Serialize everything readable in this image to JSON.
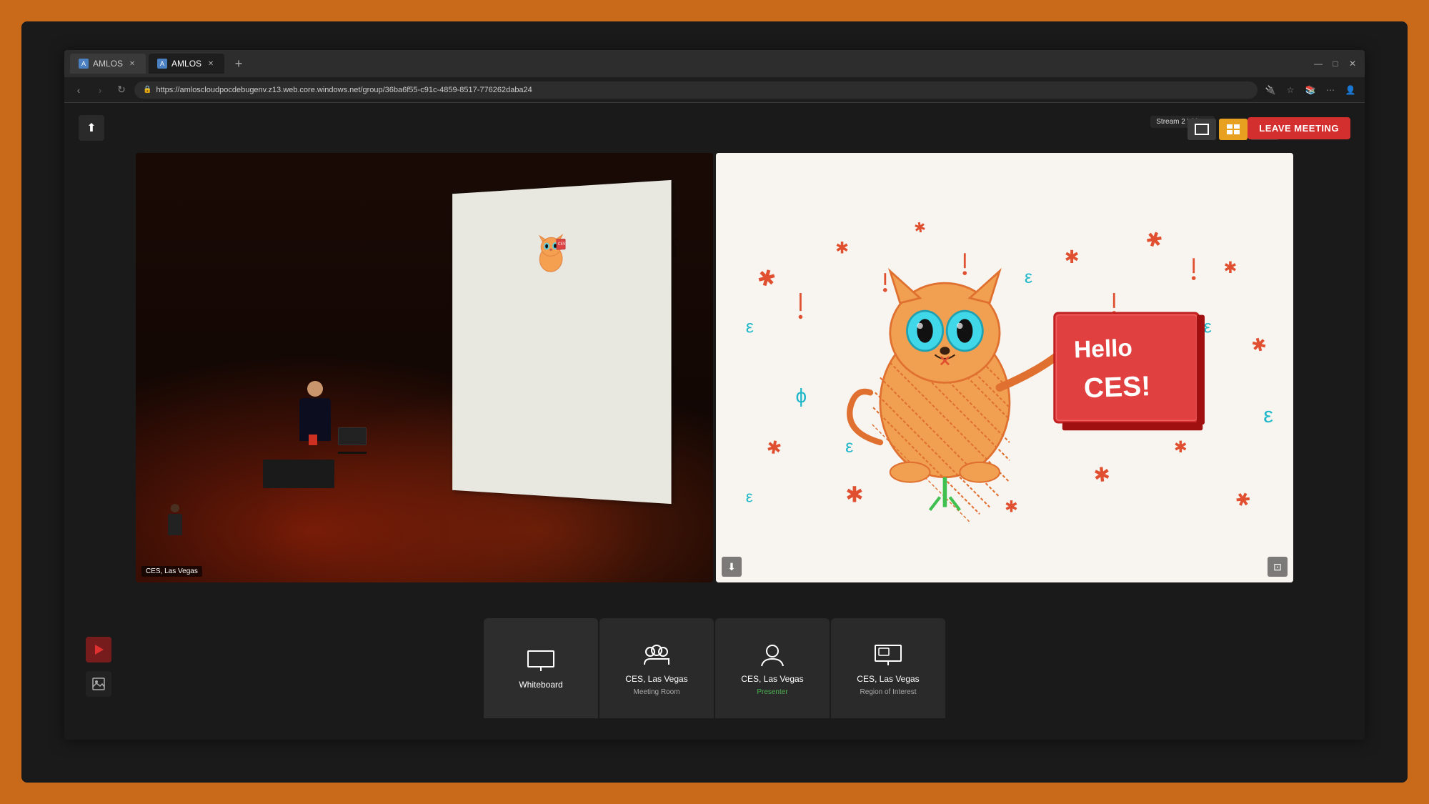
{
  "browser": {
    "tabs": [
      {
        "label": "AMLOS",
        "active": false,
        "id": "tab1"
      },
      {
        "label": "AMLOS",
        "active": true,
        "id": "tab2"
      }
    ],
    "url": "https://amloscloudpocdebugenv.z13.web.core.windows.net/group/36ba6f55-c91c-4859-8517-776262daba24",
    "new_tab_label": "+",
    "window_controls": {
      "minimize": "—",
      "maximize": "□",
      "close": "✕"
    }
  },
  "meeting": {
    "stream_label": "Stream 2 Videos",
    "leave_button_label": "LEAVE MEETING",
    "upload_icon": "⬆",
    "view_modes": [
      "single",
      "gallery",
      "list"
    ]
  },
  "videos": {
    "left": {
      "location": "CES, Las Vegas"
    },
    "right": {
      "hello_text": "Hello CES!"
    }
  },
  "bottom_bar": {
    "side_icons": [
      {
        "name": "play-icon",
        "symbol": "▶",
        "bg": "red"
      },
      {
        "name": "image-icon",
        "symbol": "🖼",
        "bg": "dark"
      }
    ],
    "participants": [
      {
        "id": "whiteboard",
        "name": "Whiteboard",
        "sub": "",
        "icon_type": "monitor"
      },
      {
        "id": "meeting-room",
        "name": "CES, Las Vegas",
        "sub": "Meeting Room",
        "icon_type": "group",
        "sub_color": "normal"
      },
      {
        "id": "presenter",
        "name": "CES, Las Vegas",
        "sub": "Presenter",
        "icon_type": "person",
        "sub_color": "green"
      },
      {
        "id": "region",
        "name": "CES, Las Vegas",
        "sub": "Region of Interest",
        "icon_type": "monitor-small",
        "sub_color": "normal"
      }
    ]
  }
}
